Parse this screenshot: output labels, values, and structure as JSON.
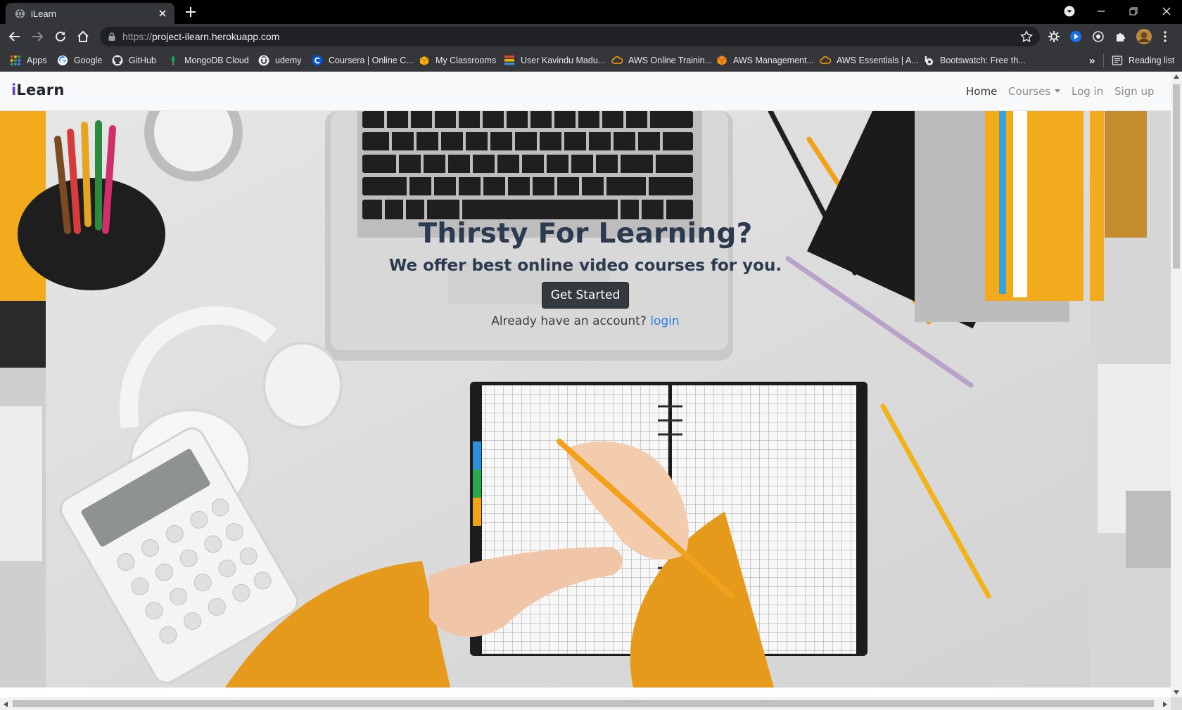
{
  "browser": {
    "tab_title": "iLearn",
    "url_scheme": "https://",
    "url_host": "project-ilearn.herokuapp.com",
    "bookmarks": [
      {
        "label": "Apps",
        "icon": "apps-grid-icon"
      },
      {
        "label": "Google",
        "icon": "google-icon"
      },
      {
        "label": "GitHub",
        "icon": "github-icon"
      },
      {
        "label": "MongoDB Cloud",
        "icon": "mongodb-leaf-icon"
      },
      {
        "label": "udemy",
        "icon": "udemy-icon"
      },
      {
        "label": "Coursera | Online C...",
        "icon": "coursera-icon"
      },
      {
        "label": "My Classrooms",
        "icon": "classroom-icon"
      },
      {
        "label": "User Kavindu Madu...",
        "icon": "stackexchange-icon"
      },
      {
        "label": "AWS Online Trainin...",
        "icon": "aws-cloud-icon"
      },
      {
        "label": "AWS Management...",
        "icon": "aws-cube-icon"
      },
      {
        "label": "AWS Essentials | A...",
        "icon": "aws-cloud-icon"
      },
      {
        "label": "Bootswatch: Free th...",
        "icon": "bootswatch-icon"
      }
    ],
    "more_bookmarks": "»",
    "reading_list": "Reading list"
  },
  "site": {
    "brand_i": "i",
    "brand_rest": "Learn",
    "nav": {
      "home": "Home",
      "courses": "Courses",
      "login": "Log in",
      "signup": "Sign up"
    },
    "hero": {
      "title": "Thirsty For Learning?",
      "subtitle": "We offer best online video courses for you.",
      "cta": "Get Started",
      "account_prompt": "Already have an account?",
      "login_link": "login"
    }
  },
  "colors": {
    "chrome_dark": "#35363a",
    "hero_text": "#2b3a4e",
    "link": "#2d7be0",
    "button": "#343a40",
    "accent_yellow": "#f0a21a"
  }
}
